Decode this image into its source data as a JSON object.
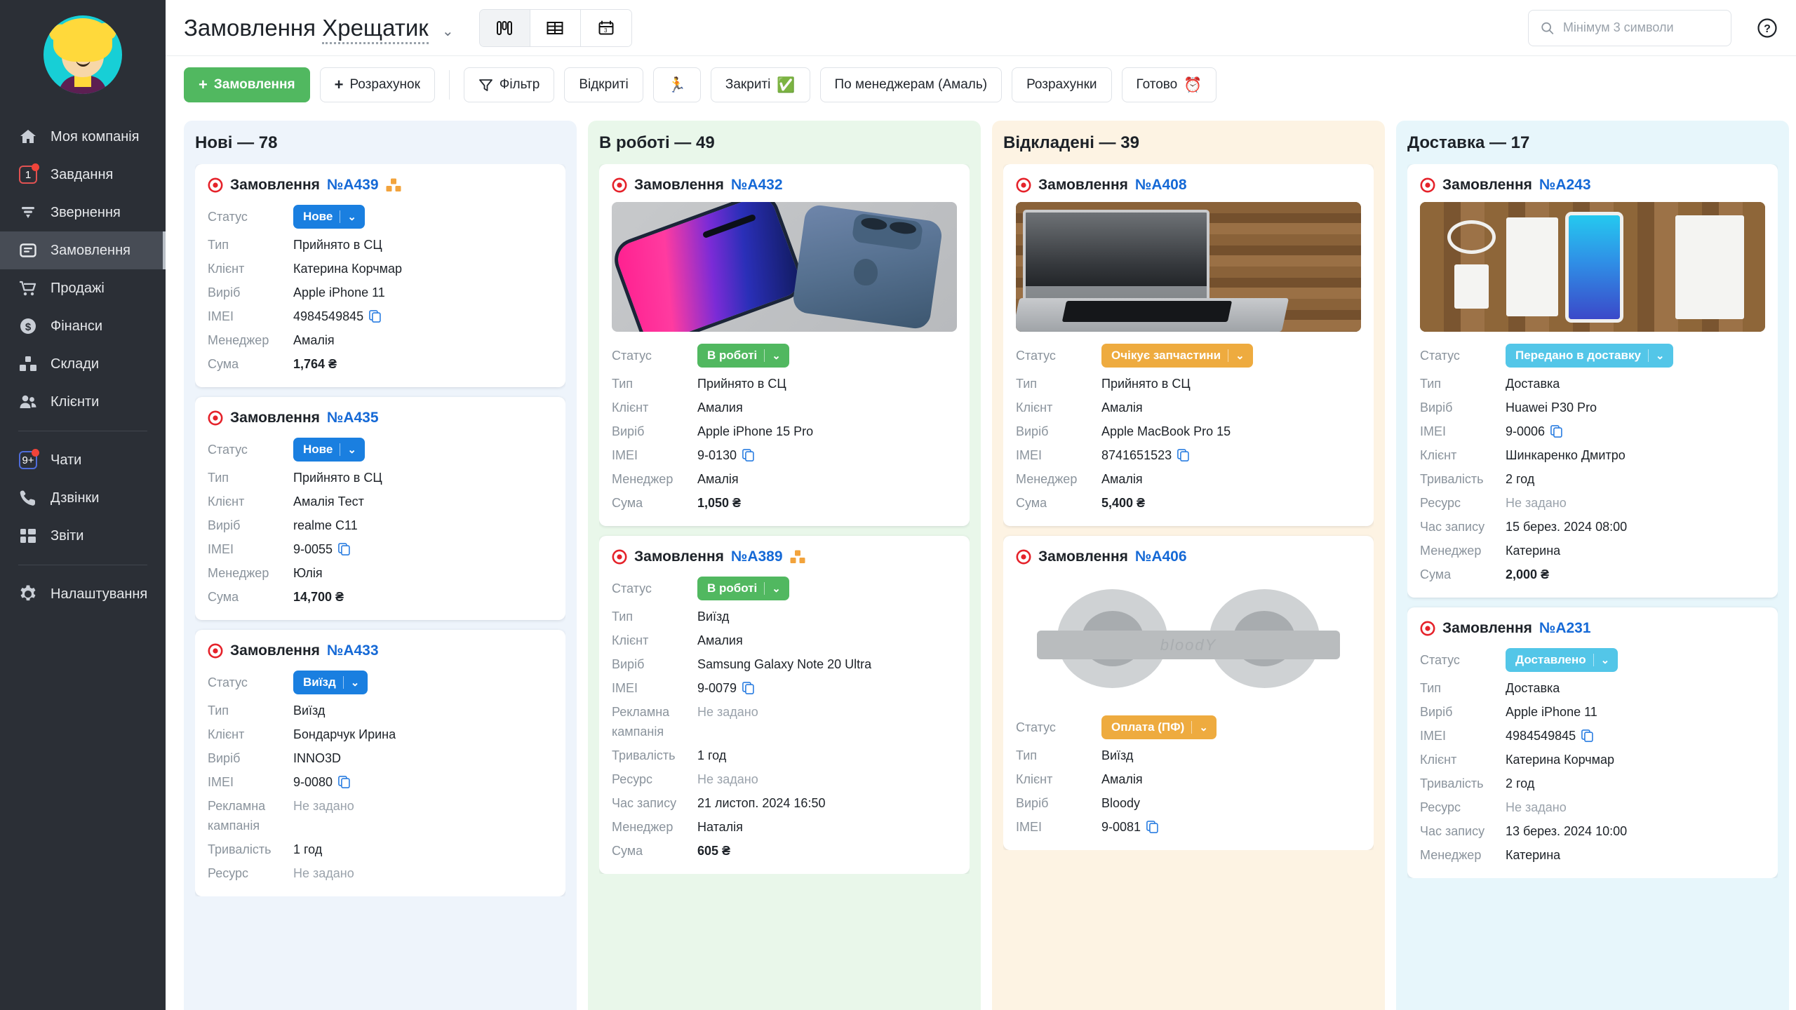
{
  "sidebar": {
    "avatar_alt": "user-avatar",
    "items": [
      {
        "label": "Моя компанія",
        "icon": "home-icon",
        "badge": null,
        "active": false
      },
      {
        "label": "Завдання",
        "icon": "task-badge-icon",
        "badge": "1",
        "active": false
      },
      {
        "label": "Звернення",
        "icon": "funnel-icon",
        "badge": null,
        "active": false
      },
      {
        "label": "Замовлення",
        "icon": "inbox-icon",
        "badge": null,
        "active": true
      },
      {
        "label": "Продажі",
        "icon": "cart-icon",
        "badge": null,
        "active": false
      },
      {
        "label": "Фінанси",
        "icon": "dollar-circle-icon",
        "badge": null,
        "active": false
      },
      {
        "label": "Склади",
        "icon": "boxes-icon",
        "badge": null,
        "active": false
      },
      {
        "label": "Клієнти",
        "icon": "users-icon",
        "badge": null,
        "active": false
      },
      {
        "label": "Чати",
        "icon": "chat-badge-icon",
        "badge": "9+",
        "active": false
      },
      {
        "label": "Дзвінки",
        "icon": "phone-icon",
        "badge": null,
        "active": false
      },
      {
        "label": "Звіти",
        "icon": "reports-grid-icon",
        "badge": null,
        "active": false
      },
      {
        "label": "Налаштування",
        "icon": "gear-icon",
        "badge": null,
        "active": false
      }
    ]
  },
  "topbar": {
    "title_main": "Замовлення",
    "title_dotted": "Хрещатик",
    "caret": "⌄",
    "views": [
      {
        "name": "kanban-view",
        "active": true
      },
      {
        "name": "table-view",
        "active": false
      },
      {
        "name": "calendar-view",
        "active": false
      }
    ],
    "search_placeholder": "Мінімум 3 символи",
    "search_value": "",
    "help_icon": "question-circle-icon"
  },
  "toolbar": {
    "new_order": "Замовлення",
    "new_estimate": "Розрахунок",
    "filter": "Фільтр",
    "open": "Відкриті",
    "runner_emoji": "🏃",
    "closed": "Закриті",
    "closed_emoji": "✅",
    "by_manager": "По менеджерам (Амаль)",
    "estimates": "Розрахунки",
    "ready": "Готово",
    "ready_emoji": "⏰"
  },
  "labels": {
    "status": "Статус",
    "type": "Тип",
    "client": "Клієнт",
    "product": "Виріб",
    "imei": "IMEI",
    "manager": "Менеджер",
    "sum": "Сума",
    "campaign": "Рекламна кампанія",
    "duration": "Тривалість",
    "resource": "Ресурс",
    "record_time": "Час запису",
    "order_word": "Замовлення"
  },
  "colors": {
    "status_new": "#1a7fe0",
    "status_work": "#51b860",
    "status_wait": "#eeab3f",
    "status_delivery": "#53c6e8",
    "column_new_bg": "#eef4fb",
    "column_work_bg": "#e9f7ea",
    "column_hold_bg": "#fdf3e3",
    "column_delivery_bg": "#e7f6fb",
    "link": "#1569d6",
    "accent_green": "#51b860"
  },
  "board": {
    "columns": [
      {
        "title": "Нові — 78",
        "theme": "new",
        "cards": [
          {
            "number": "№A439",
            "has_box_icon": true,
            "thumb": null,
            "status": {
              "text": "Нове",
              "color": "#1a7fe0"
            },
            "fields": [
              {
                "label": "Тип",
                "value": "Прийнято в СЦ"
              },
              {
                "label": "Клієнт",
                "value": "Катерина Корчмар"
              },
              {
                "label": "Виріб",
                "value": "Apple iPhone 11"
              },
              {
                "label": "IMEI",
                "value": "4984549845",
                "copy": true
              },
              {
                "label": "Менеджер",
                "value": "Амалія"
              },
              {
                "label": "Сума",
                "value": "1,764 ₴",
                "bold": true
              }
            ]
          },
          {
            "number": "№A435",
            "has_box_icon": false,
            "thumb": null,
            "status": {
              "text": "Нове",
              "color": "#1a7fe0"
            },
            "fields": [
              {
                "label": "Тип",
                "value": "Прийнято в СЦ"
              },
              {
                "label": "Клієнт",
                "value": "Амалія Тест"
              },
              {
                "label": "Виріб",
                "value": "realme C11"
              },
              {
                "label": "IMEI",
                "value": "9-0055",
                "copy": true
              },
              {
                "label": "Менеджер",
                "value": "Юлія"
              },
              {
                "label": "Сума",
                "value": "14,700 ₴",
                "bold": true
              }
            ]
          },
          {
            "number": "№A433",
            "has_box_icon": false,
            "thumb": null,
            "status": {
              "text": "Виїзд",
              "color": "#1a7fe0"
            },
            "fields": [
              {
                "label": "Тип",
                "value": "Виїзд"
              },
              {
                "label": "Клієнт",
                "value": "Бондарчук Ирина"
              },
              {
                "label": "Виріб",
                "value": "INNO3D"
              },
              {
                "label": "IMEI",
                "value": "9-0080",
                "copy": true
              },
              {
                "label": "Рекламна кампанія",
                "value": "Не задано",
                "muted": true
              },
              {
                "label": "Тривалість",
                "value": "1 год"
              },
              {
                "label": "Ресурс",
                "value": "Не задано",
                "muted": true
              }
            ]
          }
        ]
      },
      {
        "title": "В роботі — 49",
        "theme": "work",
        "cards": [
          {
            "number": "№A432",
            "has_box_icon": false,
            "thumb": "iphone",
            "status": {
              "text": "В роботі",
              "color": "#51b860"
            },
            "fields": [
              {
                "label": "Тип",
                "value": "Прийнято в СЦ"
              },
              {
                "label": "Клієнт",
                "value": "Амалия"
              },
              {
                "label": "Виріб",
                "value": "Apple iPhone 15 Pro"
              },
              {
                "label": "IMEI",
                "value": "9-0130",
                "copy": true
              },
              {
                "label": "Менеджер",
                "value": "Амалія"
              },
              {
                "label": "Сума",
                "value": "1,050 ₴",
                "bold": true
              }
            ]
          },
          {
            "number": "№A389",
            "has_box_icon": true,
            "thumb": null,
            "status": {
              "text": "В роботі",
              "color": "#51b860"
            },
            "fields": [
              {
                "label": "Тип",
                "value": "Виїзд"
              },
              {
                "label": "Клієнт",
                "value": "Амалия"
              },
              {
                "label": "Виріб",
                "value": "Samsung Galaxy Note 20 Ultra"
              },
              {
                "label": "IMEI",
                "value": "9-0079",
                "copy": true
              },
              {
                "label": "Рекламна кампанія",
                "value": "Не задано",
                "muted": true
              },
              {
                "label": "Тривалість",
                "value": "1 год"
              },
              {
                "label": "Ресурс",
                "value": "Не задано",
                "muted": true
              },
              {
                "label": "Час запису",
                "value": "21 листоп. 2024 16:50"
              },
              {
                "label": "Менеджер",
                "value": "Наталія"
              },
              {
                "label": "Сума",
                "value": "605 ₴",
                "bold": true
              }
            ]
          }
        ]
      },
      {
        "title": "Відкладені — 39",
        "theme": "hold",
        "cards": [
          {
            "number": "№A408",
            "has_box_icon": false,
            "thumb": "macbook",
            "status": {
              "text": "Очікує запчастини",
              "color": "#eeab3f"
            },
            "fields": [
              {
                "label": "Тип",
                "value": "Прийнято в СЦ"
              },
              {
                "label": "Клієнт",
                "value": "Амалія"
              },
              {
                "label": "Виріб",
                "value": "Apple MacBook Pro 15"
              },
              {
                "label": "IMEI",
                "value": "8741651523",
                "copy": true
              },
              {
                "label": "Менеджер",
                "value": "Амалія"
              },
              {
                "label": "Сума",
                "value": "5,400 ₴",
                "bold": true
              }
            ]
          },
          {
            "number": "№A406",
            "has_box_icon": false,
            "thumb": "headphones",
            "status": {
              "text": "Оплата (ПФ)",
              "color": "#eeab3f"
            },
            "fields": [
              {
                "label": "Тип",
                "value": "Виїзд"
              },
              {
                "label": "Клієнт",
                "value": "Амалія"
              },
              {
                "label": "Виріб",
                "value": "Bloody"
              },
              {
                "label": "IMEI",
                "value": "9-0081",
                "copy": true
              }
            ]
          }
        ]
      },
      {
        "title": "Доставка — 17",
        "theme": "delivery",
        "cards": [
          {
            "number": "№A243",
            "has_box_icon": false,
            "thumb": "huawei",
            "status": {
              "text": "Передано в доставку",
              "color": "#53c6e8"
            },
            "fields": [
              {
                "label": "Тип",
                "value": "Доставка"
              },
              {
                "label": "Виріб",
                "value": "Huawei P30 Pro"
              },
              {
                "label": "IMEI",
                "value": "9-0006",
                "copy": true
              },
              {
                "label": "Клієнт",
                "value": "Шинкаренко Дмитро"
              },
              {
                "label": "Тривалість",
                "value": "2 год"
              },
              {
                "label": "Ресурс",
                "value": "Не задано",
                "muted": true
              },
              {
                "label": "Час запису",
                "value": "15 берез. 2024 08:00"
              },
              {
                "label": "Менеджер",
                "value": "Катерина"
              },
              {
                "label": "Сума",
                "value": "2,000 ₴",
                "bold": true
              }
            ]
          },
          {
            "number": "№A231",
            "has_box_icon": false,
            "thumb": null,
            "status": {
              "text": "Доставлено",
              "color": "#53c6e8"
            },
            "fields": [
              {
                "label": "Тип",
                "value": "Доставка"
              },
              {
                "label": "Виріб",
                "value": "Apple iPhone 11"
              },
              {
                "label": "IMEI",
                "value": "4984549845",
                "copy": true
              },
              {
                "label": "Клієнт",
                "value": "Катерина Корчмар"
              },
              {
                "label": "Тривалість",
                "value": "2 год"
              },
              {
                "label": "Ресурс",
                "value": "Не задано",
                "muted": true
              },
              {
                "label": "Час запису",
                "value": "13 берез. 2024 10:00"
              },
              {
                "label": "Менеджер",
                "value": "Катерина"
              }
            ]
          }
        ]
      }
    ]
  }
}
